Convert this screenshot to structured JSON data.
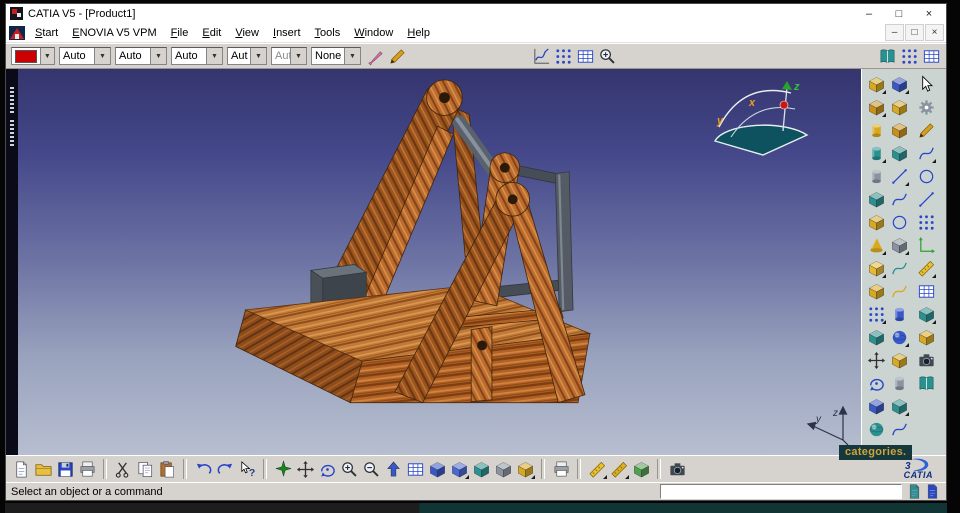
{
  "window": {
    "title": "CATIA V5 - [Product1]",
    "controls": {
      "minimize": "–",
      "maximize": "□",
      "close": "×"
    }
  },
  "menu": {
    "items": [
      "Start",
      "ENOVIA V5 VPM",
      "File",
      "Edit",
      "View",
      "Insert",
      "Tools",
      "Window",
      "Help"
    ],
    "child_controls": {
      "minimize": "–",
      "restore": "□",
      "close": "×"
    }
  },
  "toolbar_graphic": {
    "combos": [
      {
        "name": "graphic-color",
        "value": "",
        "swatch": "#cc0000"
      },
      {
        "name": "line-weight",
        "value": "Auto"
      },
      {
        "name": "line-type",
        "value": "Auto"
      },
      {
        "name": "point-symbol",
        "value": "Auto"
      },
      {
        "name": "render-mode",
        "value": "Aut"
      },
      {
        "name": "layer",
        "value": "Aut"
      },
      {
        "name": "filter",
        "value": "None"
      }
    ],
    "tool_icons": [
      {
        "name": "graphic-painter",
        "glyph": "brush",
        "color": "#e070a8"
      },
      {
        "name": "graphic-wizard",
        "glyph": "pencil",
        "color": "#d8a018"
      }
    ],
    "middle_icons": [
      {
        "name": "knowledge-formula",
        "glyph": "chart",
        "color": "#2040c0"
      },
      {
        "name": "design-table",
        "glyph": "dot-grid",
        "color": "#2846c8"
      },
      {
        "name": "knowledge-grid",
        "glyph": "grid",
        "color": "#2846c8"
      },
      {
        "name": "search-region",
        "glyph": "zoom-in",
        "color": "#303030"
      }
    ],
    "right_icons": [
      {
        "name": "catalog-browser",
        "glyph": "book",
        "color": "#2a9090"
      },
      {
        "name": "vpm-dot-grid",
        "glyph": "dot-grid",
        "color": "#2846c8"
      },
      {
        "name": "vpm-table",
        "glyph": "grid",
        "color": "#2846c8"
      }
    ]
  },
  "viewport": {
    "overlay_text": "categories.",
    "compass_labels": {
      "x": "x",
      "y": "y",
      "z": "z"
    },
    "triad_labels": {
      "y": "y",
      "z": "z"
    }
  },
  "right_toolbar": {
    "col1": [
      {
        "name": "pad",
        "glyph": "cube",
        "color": "#d8a820",
        "flyout": true
      },
      {
        "name": "pocket",
        "glyph": "cube",
        "color": "#c89018",
        "flyout": true
      },
      {
        "name": "shaft",
        "glyph": "cylinder",
        "color": "#d8a820"
      },
      {
        "name": "groove",
        "glyph": "cylinder",
        "color": "#2a9090",
        "flyout": true
      },
      {
        "name": "hole",
        "glyph": "cylinder",
        "color": "#8a94a0"
      },
      {
        "name": "rib",
        "glyph": "cube",
        "color": "#2a9090"
      },
      {
        "name": "stiffener",
        "glyph": "cube",
        "color": "#d8a820"
      },
      {
        "name": "loft",
        "glyph": "cone",
        "color": "#d8a820",
        "flyout": true
      },
      {
        "name": "fillet",
        "glyph": "cube",
        "color": "#e8b830",
        "flyout": true
      },
      {
        "name": "chamfer",
        "glyph": "cube",
        "color": "#d8a820"
      },
      {
        "name": "pattern",
        "glyph": "dot-grid",
        "color": "#2846c8",
        "flyout": true
      },
      {
        "name": "mirror",
        "glyph": "cube",
        "color": "#2a9090"
      },
      {
        "name": "translate",
        "glyph": "pan",
        "color": "#303030"
      },
      {
        "name": "rotate-body",
        "glyph": "rotate",
        "color": "#2846c8"
      },
      {
        "name": "scale-body",
        "glyph": "cube",
        "color": "#3858c8"
      },
      {
        "name": "close-surface",
        "glyph": "sphere",
        "color": "#2a9090"
      }
    ],
    "col2": [
      {
        "name": "assemble",
        "glyph": "cube",
        "color": "#3858c8",
        "flyout": true
      },
      {
        "name": "add-body",
        "glyph": "cube",
        "color": "#d8a820"
      },
      {
        "name": "remove-body",
        "glyph": "cube",
        "color": "#c89018"
      },
      {
        "name": "intersect-body",
        "glyph": "cube",
        "color": "#2a9090"
      },
      {
        "name": "split",
        "glyph": "line",
        "color": "#2846c8",
        "flyout": true
      },
      {
        "name": "trim",
        "glyph": "curve",
        "color": "#2846c8"
      },
      {
        "name": "boundary",
        "glyph": "circle",
        "color": "#2846c8"
      },
      {
        "name": "extract",
        "glyph": "cube",
        "color": "#8a94a0",
        "flyout": true
      },
      {
        "name": "offset-surface",
        "glyph": "curve",
        "color": "#2a9090"
      },
      {
        "name": "sweep",
        "glyph": "curve",
        "color": "#d8a820"
      },
      {
        "name": "revolve",
        "glyph": "cylinder",
        "color": "#3858c8"
      },
      {
        "name": "sphere-surface",
        "glyph": "sphere",
        "color": "#3858c8",
        "flyout": true
      },
      {
        "name": "thick-surface",
        "glyph": "cube",
        "color": "#d8a820"
      },
      {
        "name": "thread",
        "glyph": "cylinder",
        "color": "#8a94a0"
      },
      {
        "name": "draft-angle",
        "glyph": "cube",
        "color": "#2a9090",
        "flyout": true
      },
      {
        "name": "sew-surface",
        "glyph": "curve",
        "color": "#2846c8"
      }
    ],
    "col3": [
      {
        "name": "select",
        "glyph": "pointer",
        "color": "#ffffff"
      },
      {
        "name": "update",
        "glyph": "gear",
        "color": "#8a94a0"
      },
      {
        "name": "sketcher",
        "glyph": "pencil",
        "color": "#d8a018"
      },
      {
        "name": "profile",
        "glyph": "curve",
        "color": "#2846c8",
        "flyout": true
      },
      {
        "name": "circle-tool",
        "glyph": "circle",
        "color": "#2846c8"
      },
      {
        "name": "line-tool",
        "glyph": "line",
        "color": "#2846c8"
      },
      {
        "name": "point-tool",
        "glyph": "dot-grid",
        "color": "#2846c8"
      },
      {
        "name": "constraint",
        "glyph": "axis",
        "color": "#30a030"
      },
      {
        "name": "measure",
        "glyph": "ruler",
        "color": "#e8c030",
        "flyout": true
      },
      {
        "name": "work-grid",
        "glyph": "grid",
        "color": "#2846c8"
      },
      {
        "name": "view-mode",
        "glyph": "cube",
        "color": "#2a9090",
        "flyout": true
      },
      {
        "name": "apply-material",
        "glyph": "cube",
        "color": "#d8a820"
      },
      {
        "name": "render-capture",
        "glyph": "camera",
        "color": "#404850"
      },
      {
        "name": "help-library",
        "glyph": "book",
        "color": "#2a9090"
      }
    ]
  },
  "toolbar_bottom": {
    "groups": {
      "standard": [
        {
          "name": "new-document",
          "glyph": "page",
          "color": "#ffffff"
        },
        {
          "name": "open",
          "glyph": "folder",
          "color": "#e8c040"
        },
        {
          "name": "save",
          "glyph": "floppy",
          "color": "#2846c8"
        },
        {
          "name": "print",
          "glyph": "printer",
          "color": "#9aa0a8"
        }
      ],
      "clipboard": [
        {
          "name": "cut",
          "glyph": "scissors",
          "color": "#303030"
        },
        {
          "name": "copy",
          "glyph": "copy",
          "color": "#ffffff"
        },
        {
          "name": "paste",
          "glyph": "paste",
          "color": "#b07030"
        }
      ],
      "edit": [
        {
          "name": "undo",
          "glyph": "undo",
          "color": "#2846c8"
        },
        {
          "name": "redo",
          "glyph": "redo",
          "color": "#2846c8"
        },
        {
          "name": "whats-this",
          "glyph": "help-pointer",
          "color": "#303030"
        }
      ],
      "view": [
        {
          "name": "fly-mode",
          "glyph": "star4",
          "color": "#208020"
        },
        {
          "name": "pan",
          "glyph": "pan",
          "color": "#303030"
        },
        {
          "name": "rotate-view",
          "glyph": "rotate",
          "color": "#2846c8"
        },
        {
          "name": "zoom-in",
          "glyph": "zoom-in",
          "color": "#303030"
        },
        {
          "name": "zoom-out",
          "glyph": "zoom-out",
          "color": "#303030"
        },
        {
          "name": "normal-view",
          "glyph": "arrow-up",
          "color": "#3858c8"
        },
        {
          "name": "multi-view",
          "glyph": "grid",
          "color": "#2846c8"
        },
        {
          "name": "iso-view",
          "glyph": "cube",
          "color": "#3858c8"
        },
        {
          "name": "shading",
          "glyph": "cube",
          "color": "#4868d8",
          "flyout": true
        },
        {
          "name": "shading-edges",
          "glyph": "cube",
          "color": "#2a9090"
        },
        {
          "name": "wireframe",
          "glyph": "cube",
          "color": "#8a94a0"
        },
        {
          "name": "hide-show",
          "glyph": "cube",
          "color": "#d8a820",
          "flyout": true
        }
      ],
      "print2": [
        {
          "name": "quick-print",
          "glyph": "printer",
          "color": "#9aa0a8"
        }
      ],
      "measure": [
        {
          "name": "measure-between",
          "glyph": "ruler",
          "color": "#e8c030",
          "flyout": true
        },
        {
          "name": "measure-item",
          "glyph": "ruler",
          "color": "#d8b020",
          "flyout": true
        },
        {
          "name": "measure-inertia",
          "glyph": "cube",
          "color": "#50a050"
        }
      ],
      "capture": [
        {
          "name": "screen-capture",
          "glyph": "camera",
          "color": "#404850"
        }
      ]
    },
    "brand": {
      "logo_text": "3",
      "label": "CATIA"
    }
  },
  "statusbar": {
    "message": "Select an object or a command",
    "command_value": "",
    "icons": [
      {
        "name": "power-input-doc",
        "glyph": "page",
        "color": "#2a9090"
      },
      {
        "name": "linked-doc",
        "glyph": "page",
        "color": "#2846c8"
      }
    ]
  }
}
